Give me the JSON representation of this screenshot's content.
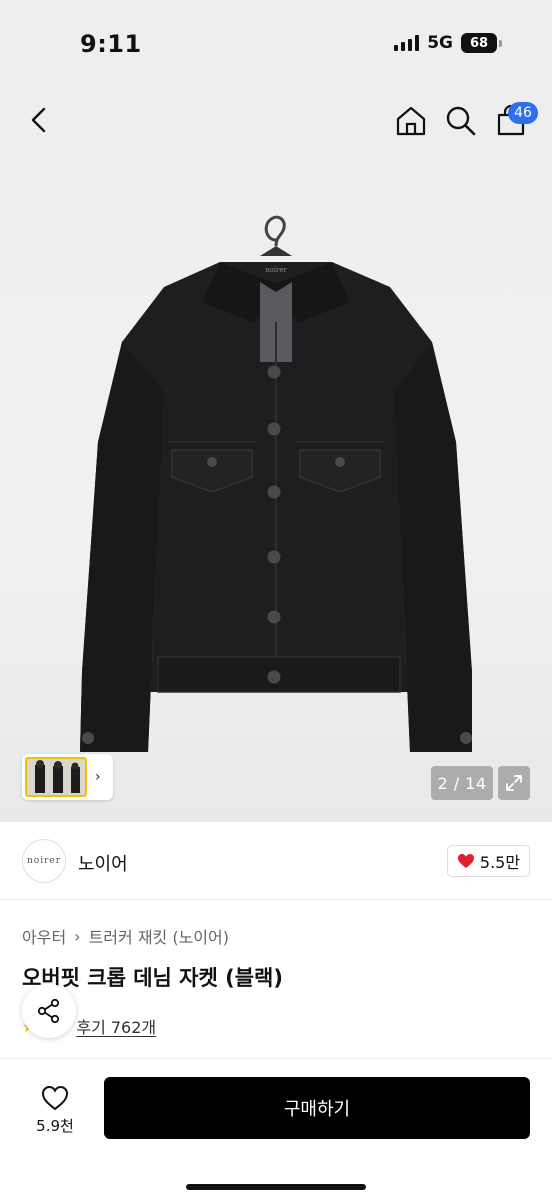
{
  "status_bar": {
    "time": "9:11",
    "network": "5G",
    "battery": "68"
  },
  "header": {
    "cart_count": "46"
  },
  "gallery": {
    "counter": "2 / 14",
    "thumbnail_more": "›"
  },
  "jacket_label": "noirer",
  "brand": {
    "logo_text": "noirer",
    "name": "노이어",
    "likes": "5.5만"
  },
  "product": {
    "breadcrumb": [
      "아우터",
      "트러커 재킷 (노이어)"
    ],
    "breadcrumb_separator": "›",
    "title": "오버핏 크롭 데님 자켓 (블랙)",
    "review_text": "후기 762개"
  },
  "bottom": {
    "wish_count": "5.9천",
    "buy_label": "구매하기"
  },
  "colors": {
    "accent": "#2f6fed",
    "heart": "#e0202f",
    "buy_button": "#000000"
  }
}
